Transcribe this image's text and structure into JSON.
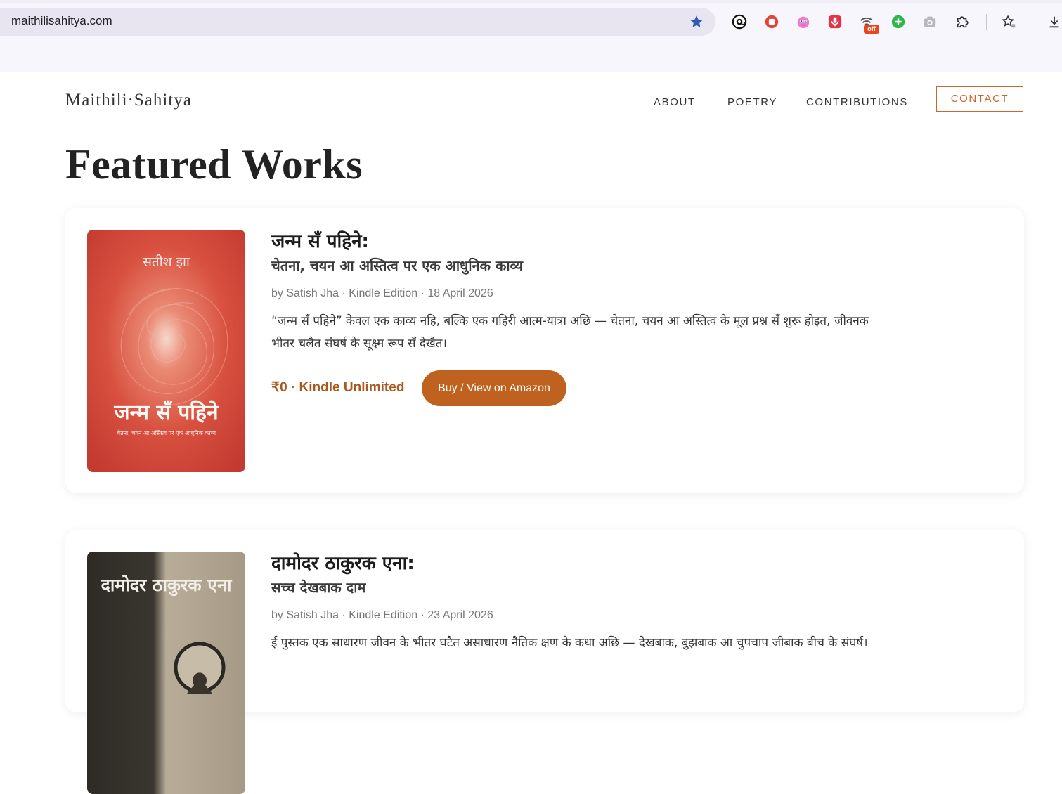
{
  "browser": {
    "url": "maithilisahitya.com",
    "extension_badge": "off",
    "icons": [
      "star-icon",
      "extension-threads-icon",
      "extension-stop-icon",
      "extension-mascot-icon",
      "extension-mic-icon",
      "extension-wifi-icon",
      "extension-add-icon",
      "extension-camera-icon",
      "extensions-puzzle-icon",
      "bookmarks-icon",
      "download-icon"
    ]
  },
  "site": {
    "logo": "Maithili·Sahitya",
    "nav": {
      "about": "ABOUT",
      "poetry": "POETRY",
      "contributions": "CONTRIBUTIONS",
      "contact": "CONTACT"
    },
    "accent_color": "#c0621f"
  },
  "page": {
    "title": "Featured Works"
  },
  "books": [
    {
      "cover_author": "सतीश झा",
      "cover_title": "जन्म सँ पहिने",
      "cover_subtitle": "चेतना, चयन आ अस्तित्व पर एक आधुनिक काव्य",
      "title": "जन्म सँ पहिने:",
      "subtitle": "चेतना, चयन आ अस्तित्व पर एक आधुनिक काव्य",
      "meta": "by Satish Jha · Kindle Edition · 18 April 2026",
      "description": "“जन्म सँ पहिने” केवल एक काव्य नहि, बल्कि एक गहिरी आत्म-यात्रा अछि — चेतना, चयन आ अस्तित्व के मूल प्रश्न सँ शुरू होइत, जीवनक भीतर चलैत संघर्ष के सूक्ष्म रूप सँ देखैत।",
      "price": "₹0 · Kindle Unlimited",
      "buy_label": "Buy / View on Amazon"
    },
    {
      "cover_title": "दामोदर ठाकुरक एना",
      "title": "दामोदर ठाकुरक एना:",
      "subtitle": "सच्च देखबाक दाम",
      "meta": "by Satish Jha · Kindle Edition · 23 April 2026",
      "description": "ई पुस्तक एक साधारण जीवन के भीतर घटैत असाधारण नैतिक क्षण के कथा अछि — देखबाक, बुझबाक आ चुपचाप जीबाक बीच के संघर्ष।"
    }
  ]
}
